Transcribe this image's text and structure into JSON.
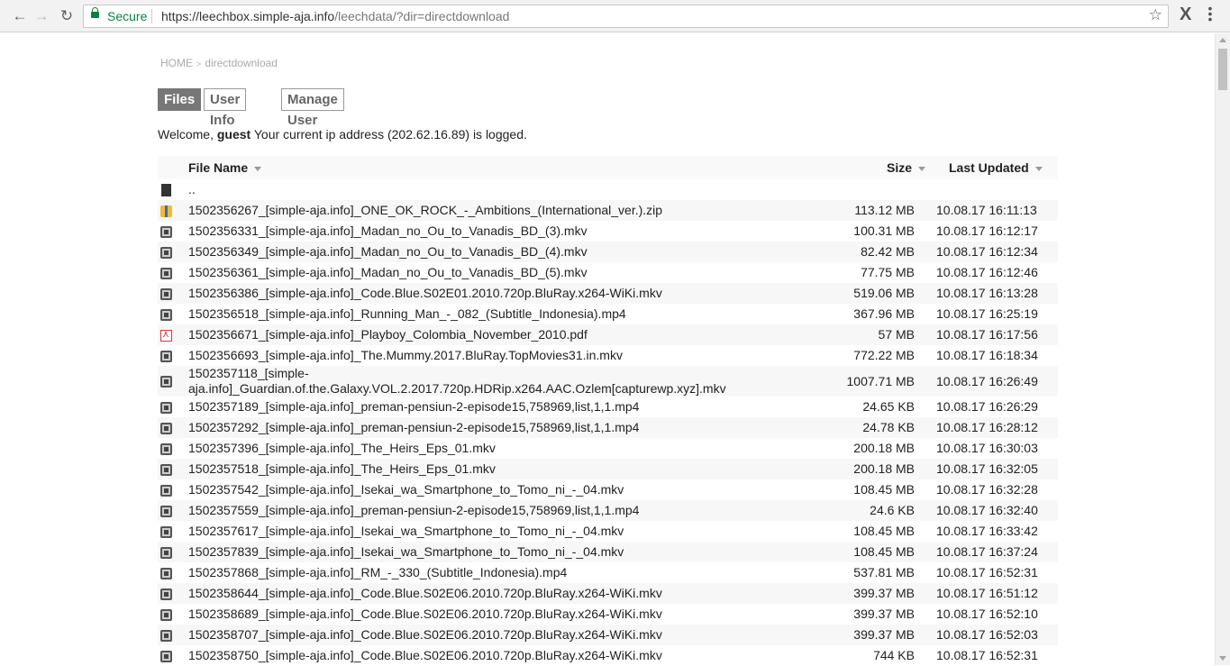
{
  "browser": {
    "secure_label": "Secure",
    "url_host": "https://leechbox.simple-aja.info",
    "url_path": "/leechdata/?dir=directdownload"
  },
  "breadcrumb": {
    "home": "HOME",
    "separator": ">",
    "current": "directdownload"
  },
  "tabs": [
    {
      "label": "Files",
      "active": true
    },
    {
      "label": "User Info",
      "active": false
    },
    {
      "label": "Manage User",
      "active": false
    }
  ],
  "welcome": {
    "prefix": "Welcome,",
    "user": "guest",
    "message": "Your current ip address (202.62.16.89) is logged."
  },
  "table": {
    "headers": {
      "name": "File Name",
      "size": "Size",
      "updated": "Last Updated"
    },
    "parent": "..",
    "rows": [
      {
        "icon": "zip-icon",
        "name": "1502356267_[simple-aja.info]_ONE_OK_ROCK_-_Ambitions_(International_ver.).zip",
        "size": "113.12 MB",
        "updated": "10.08.17 16:11:13"
      },
      {
        "icon": "video-icon",
        "name": "1502356331_[simple-aja.info]_Madan_no_Ou_to_Vanadis_BD_(3).mkv",
        "size": "100.31 MB",
        "updated": "10.08.17 16:12:17"
      },
      {
        "icon": "video-icon",
        "name": "1502356349_[simple-aja.info]_Madan_no_Ou_to_Vanadis_BD_(4).mkv",
        "size": "82.42 MB",
        "updated": "10.08.17 16:12:34"
      },
      {
        "icon": "video-icon",
        "name": "1502356361_[simple-aja.info]_Madan_no_Ou_to_Vanadis_BD_(5).mkv",
        "size": "77.75 MB",
        "updated": "10.08.17 16:12:46"
      },
      {
        "icon": "video-icon",
        "name": "1502356386_[simple-aja.info]_Code.Blue.S02E01.2010.720p.BluRay.x264-WiKi.mkv",
        "size": "519.06 MB",
        "updated": "10.08.17 16:13:28"
      },
      {
        "icon": "video-icon",
        "name": "1502356518_[simple-aja.info]_Running_Man_-_082_(Subtitle_Indonesia).mp4",
        "size": "367.96 MB",
        "updated": "10.08.17 16:25:19"
      },
      {
        "icon": "pdf-icon",
        "name": "1502356671_[simple-aja.info]_Playboy_Colombia_November_2010.pdf",
        "size": "57 MB",
        "updated": "10.08.17 16:17:56"
      },
      {
        "icon": "video-icon",
        "name": "1502356693_[simple-aja.info]_The.Mummy.2017.BluRay.TopMovies31.in.mkv",
        "size": "772.22 MB",
        "updated": "10.08.17 16:18:34"
      },
      {
        "icon": "video-icon",
        "name": "1502357118_[simple-aja.info]_Guardian.of.the.Galaxy.VOL.2.2017.720p.HDRip.x264.AAC.Ozlem[capturewp.xyz].mkv",
        "size": "1007.71 MB",
        "updated": "10.08.17 16:26:49"
      },
      {
        "icon": "video-icon",
        "name": "1502357189_[simple-aja.info]_preman-pensiun-2-episode15,758969,list,1,1.mp4",
        "size": "24.65 KB",
        "updated": "10.08.17 16:26:29"
      },
      {
        "icon": "video-icon",
        "name": "1502357292_[simple-aja.info]_preman-pensiun-2-episode15,758969,list,1,1.mp4",
        "size": "24.78 KB",
        "updated": "10.08.17 16:28:12"
      },
      {
        "icon": "video-icon",
        "name": "1502357396_[simple-aja.info]_The_Heirs_Eps_01.mkv",
        "size": "200.18 MB",
        "updated": "10.08.17 16:30:03"
      },
      {
        "icon": "video-icon",
        "name": "1502357518_[simple-aja.info]_The_Heirs_Eps_01.mkv",
        "size": "200.18 MB",
        "updated": "10.08.17 16:32:05"
      },
      {
        "icon": "video-icon",
        "name": "1502357542_[simple-aja.info]_Isekai_wa_Smartphone_to_Tomo_ni_-_04.mkv",
        "size": "108.45 MB",
        "updated": "10.08.17 16:32:28"
      },
      {
        "icon": "video-icon",
        "name": "1502357559_[simple-aja.info]_preman-pensiun-2-episode15,758969,list,1,1.mp4",
        "size": "24.6 KB",
        "updated": "10.08.17 16:32:40"
      },
      {
        "icon": "video-icon",
        "name": "1502357617_[simple-aja.info]_Isekai_wa_Smartphone_to_Tomo_ni_-_04.mkv",
        "size": "108.45 MB",
        "updated": "10.08.17 16:33:42"
      },
      {
        "icon": "video-icon",
        "name": "1502357839_[simple-aja.info]_Isekai_wa_Smartphone_to_Tomo_ni_-_04.mkv",
        "size": "108.45 MB",
        "updated": "10.08.17 16:37:24"
      },
      {
        "icon": "video-icon",
        "name": "1502357868_[simple-aja.info]_RM_-_330_(Subtitle_Indonesia).mp4",
        "size": "537.81 MB",
        "updated": "10.08.17 16:52:31"
      },
      {
        "icon": "video-icon",
        "name": "1502358644_[simple-aja.info]_Code.Blue.S02E06.2010.720p.BluRay.x264-WiKi.mkv",
        "size": "399.37 MB",
        "updated": "10.08.17 16:51:12"
      },
      {
        "icon": "video-icon",
        "name": "1502358689_[simple-aja.info]_Code.Blue.S02E06.2010.720p.BluRay.x264-WiKi.mkv",
        "size": "399.37 MB",
        "updated": "10.08.17 16:52:10"
      },
      {
        "icon": "video-icon",
        "name": "1502358707_[simple-aja.info]_Code.Blue.S02E06.2010.720p.BluRay.x264-WiKi.mkv",
        "size": "399.37 MB",
        "updated": "10.08.17 16:52:03"
      },
      {
        "icon": "video-icon",
        "name": "1502358750_[simple-aja.info]_Code.Blue.S02E06.2010.720p.BluRay.x264-WiKi.mkv",
        "size": "744 KB",
        "updated": "10.08.17 16:52:31"
      }
    ]
  }
}
